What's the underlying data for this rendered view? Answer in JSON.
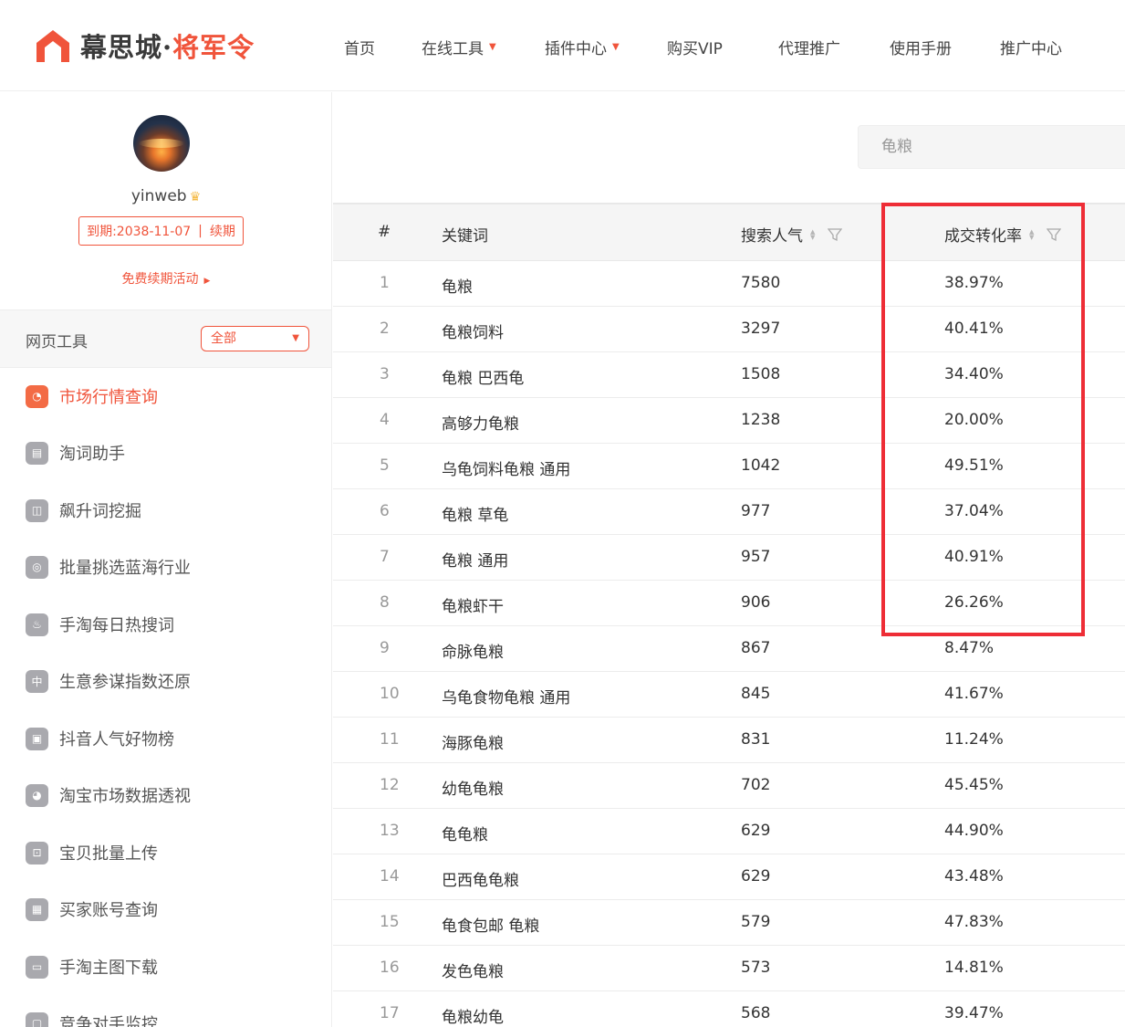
{
  "header": {
    "logo": {
      "part1": "幕思城",
      "dot": "·",
      "part2": "将军令"
    },
    "nav": [
      {
        "label": "首页",
        "dropdown": false
      },
      {
        "label": "在线工具",
        "dropdown": true
      },
      {
        "label": "插件中心",
        "dropdown": true
      },
      {
        "label": "购买VIP",
        "dropdown": false
      },
      {
        "label": "代理推广",
        "dropdown": false
      },
      {
        "label": "使用手册",
        "dropdown": false
      },
      {
        "label": "推广中心",
        "dropdown": false
      }
    ]
  },
  "sidebar": {
    "username": "yinweb",
    "expire_text": "到期:2038-11-07",
    "renew_label": "续期",
    "renew_activity": "免费续期活动",
    "tools_title": "网页工具",
    "filter_value": "全部",
    "items": [
      {
        "label": "市场行情查询",
        "active": true
      },
      {
        "label": "淘词助手",
        "active": false
      },
      {
        "label": "飙升词挖掘",
        "active": false
      },
      {
        "label": "批量挑选蓝海行业",
        "active": false
      },
      {
        "label": "手淘每日热搜词",
        "active": false
      },
      {
        "label": "生意参谋指数还原",
        "active": false
      },
      {
        "label": "抖音人气好物榜",
        "active": false
      },
      {
        "label": "淘宝市场数据透视",
        "active": false
      },
      {
        "label": "宝贝批量上传",
        "active": false
      },
      {
        "label": "买家账号查询",
        "active": false
      },
      {
        "label": "手淘主图下载",
        "active": false
      },
      {
        "label": "竞争对手监控",
        "active": false
      }
    ]
  },
  "search": {
    "value": "龟粮"
  },
  "table": {
    "headers": {
      "index": "#",
      "keyword": "关键词",
      "popularity": "搜索人气",
      "conversion": "成交转化率"
    },
    "rows": [
      {
        "index": "1",
        "keyword": "龟粮",
        "popularity": "7580",
        "conversion": "38.97%"
      },
      {
        "index": "2",
        "keyword": "龟粮饲料",
        "popularity": "3297",
        "conversion": "40.41%"
      },
      {
        "index": "3",
        "keyword": "龟粮 巴西龟",
        "popularity": "1508",
        "conversion": "34.40%"
      },
      {
        "index": "4",
        "keyword": "高够力龟粮",
        "popularity": "1238",
        "conversion": "20.00%"
      },
      {
        "index": "5",
        "keyword": "乌龟饲料龟粮 通用",
        "popularity": "1042",
        "conversion": "49.51%"
      },
      {
        "index": "6",
        "keyword": "龟粮 草龟",
        "popularity": "977",
        "conversion": "37.04%"
      },
      {
        "index": "7",
        "keyword": "龟粮 通用",
        "popularity": "957",
        "conversion": "40.91%"
      },
      {
        "index": "8",
        "keyword": "龟粮虾干",
        "popularity": "906",
        "conversion": "26.26%"
      },
      {
        "index": "9",
        "keyword": "命脉龟粮",
        "popularity": "867",
        "conversion": "8.47%"
      },
      {
        "index": "10",
        "keyword": "乌龟食物龟粮 通用",
        "popularity": "845",
        "conversion": "41.67%"
      },
      {
        "index": "11",
        "keyword": "海豚龟粮",
        "popularity": "831",
        "conversion": "11.24%"
      },
      {
        "index": "12",
        "keyword": "幼龟龟粮",
        "popularity": "702",
        "conversion": "45.45%"
      },
      {
        "index": "13",
        "keyword": "龟龟粮",
        "popularity": "629",
        "conversion": "44.90%"
      },
      {
        "index": "14",
        "keyword": "巴西龟龟粮",
        "popularity": "629",
        "conversion": "43.48%"
      },
      {
        "index": "15",
        "keyword": "龟食包邮 龟粮",
        "popularity": "579",
        "conversion": "47.83%"
      },
      {
        "index": "16",
        "keyword": "发色龟粮",
        "popularity": "573",
        "conversion": "14.81%"
      },
      {
        "index": "17",
        "keyword": "龟粮幼龟",
        "popularity": "568",
        "conversion": "39.47%"
      }
    ]
  },
  "colors": {
    "accent": "#f0543b",
    "highlight": "#ee2d36",
    "icon_gray": "#a9a9ae"
  }
}
